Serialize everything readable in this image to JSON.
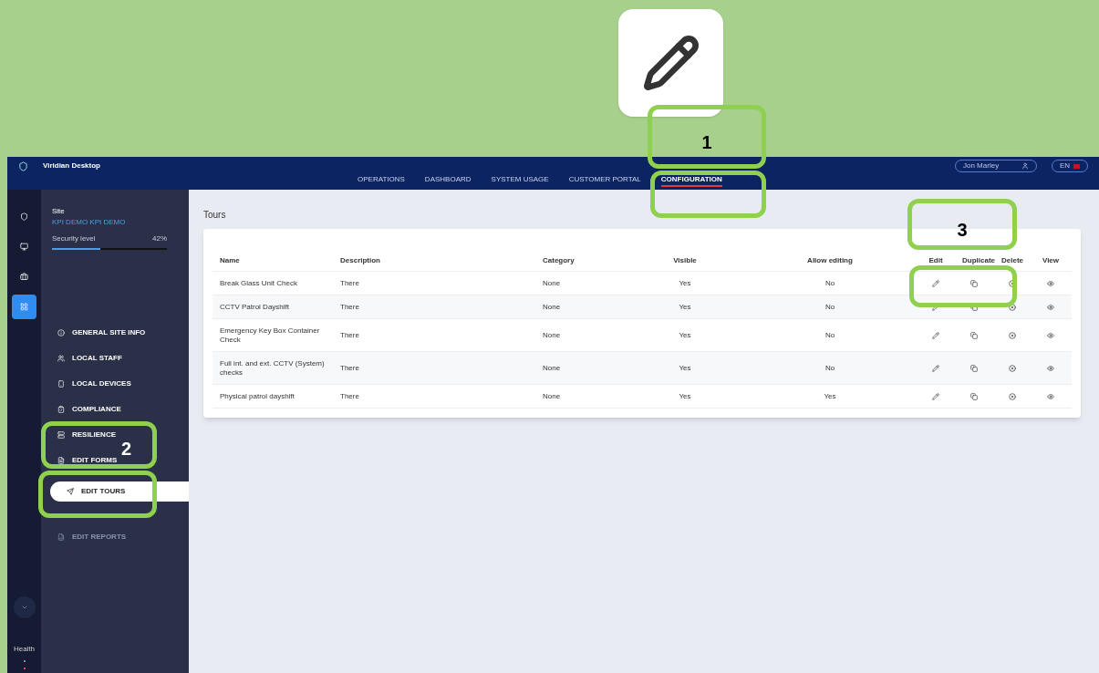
{
  "header": {
    "app_title": "Viridian Desktop",
    "user": "Jon Marley",
    "language": "EN"
  },
  "nav_tabs": [
    {
      "label": "OPERATIONS",
      "selected": false
    },
    {
      "label": "DASHBOARD",
      "selected": false
    },
    {
      "label": "SYSTEM USAGE",
      "selected": false
    },
    {
      "label": "CUSTOMER PORTAL",
      "selected": false
    },
    {
      "label": "CONFIGURATION",
      "selected": true
    }
  ],
  "rail": [
    {
      "selected": false
    },
    {
      "selected": false
    },
    {
      "selected": false
    },
    {
      "selected": true
    }
  ],
  "rail_footer": {
    "label": "Health"
  },
  "site": {
    "label": "Site",
    "name": "KPI DEMO KPI DEMO",
    "security_label": "Security level",
    "security_value": "42%",
    "level": 0.42
  },
  "sidebar_items": [
    {
      "label": "GENERAL SITE INFO",
      "selected": false,
      "disabled": false
    },
    {
      "label": "LOCAL STAFF",
      "selected": false,
      "disabled": false
    },
    {
      "label": "LOCAL DEVICES",
      "selected": false,
      "disabled": false
    },
    {
      "label": "COMPLIANCE",
      "selected": false,
      "disabled": false
    },
    {
      "label": "RESILIENCE",
      "selected": false,
      "disabled": false
    },
    {
      "label": "EDIT FORMS",
      "selected": false,
      "disabled": false
    },
    {
      "label": "EDIT TOURS",
      "selected": true,
      "disabled": false
    },
    {
      "label": "EDIT REPORTS",
      "selected": false,
      "disabled": true
    }
  ],
  "tours": {
    "title": "Tours",
    "columns": [
      "Name",
      "Description",
      "Category",
      "Visible",
      "Allow editing",
      "Edit",
      "Duplicate",
      "Delete",
      "View"
    ],
    "rows": [
      {
        "name": "Break Glass Unit Check",
        "description": "There",
        "category": "None",
        "visible": "Yes",
        "allow_editing": "No"
      },
      {
        "name": "CCTV Patrol Dayshift",
        "description": "There",
        "category": "None",
        "visible": "Yes",
        "allow_editing": "No"
      },
      {
        "name": "Emergency Key Box Container Check",
        "description": "There",
        "category": "None",
        "visible": "Yes",
        "allow_editing": "No"
      },
      {
        "name": "Full int. and ext. CCTV (System) checks",
        "description": "There",
        "category": "None",
        "visible": "Yes",
        "allow_editing": "No"
      },
      {
        "name": "Physical patrol dayshift",
        "description": "There",
        "category": "None",
        "visible": "Yes",
        "allow_editing": "Yes"
      }
    ]
  },
  "callouts": [
    {
      "label": "1"
    },
    {
      "label": "2"
    },
    {
      "label": "3"
    }
  ]
}
